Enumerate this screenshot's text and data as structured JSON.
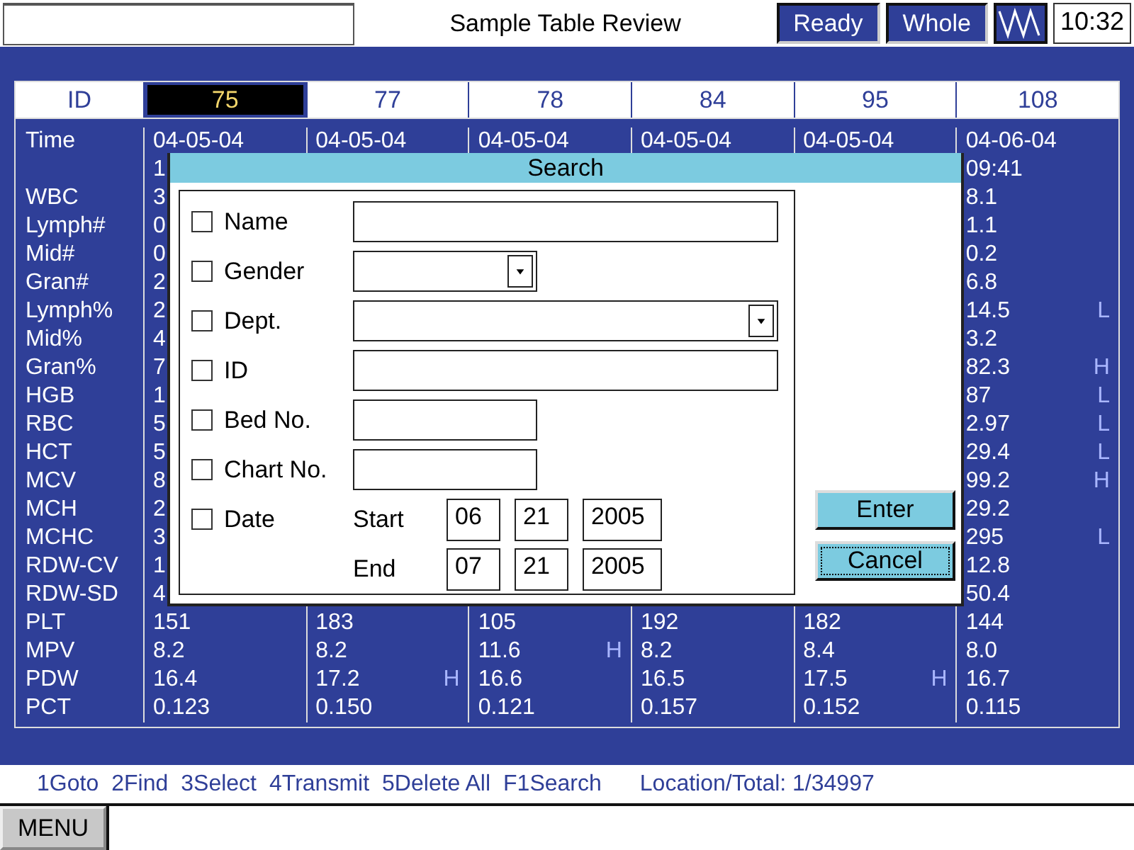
{
  "header": {
    "title": "Sample Table Review",
    "status": [
      "Ready",
      "Whole"
    ],
    "clock": "10:32"
  },
  "table": {
    "id_label": "ID",
    "columns": [
      {
        "id": "75",
        "selected": true
      },
      {
        "id": "77",
        "selected": false
      },
      {
        "id": "78",
        "selected": false
      },
      {
        "id": "84",
        "selected": false
      },
      {
        "id": "95",
        "selected": false
      },
      {
        "id": "108",
        "selected": false
      }
    ],
    "rows": [
      {
        "label": "Time",
        "cells": [
          {
            "value": "04-05-04"
          },
          {
            "value": "04-05-04"
          },
          {
            "value": "04-05-04"
          },
          {
            "value": "04-05-04"
          },
          {
            "value": "04-05-04"
          },
          {
            "value": "04-06-04"
          }
        ]
      },
      {
        "cells": [
          {
            "value": "1"
          },
          null,
          null,
          null,
          null,
          {
            "value": "09:41"
          }
        ]
      },
      {
        "label": "WBC",
        "cells": [
          {
            "value": "3"
          },
          null,
          null,
          null,
          null,
          {
            "value": "8.1"
          }
        ]
      },
      {
        "label": "Lymph#",
        "cells": [
          {
            "value": "0"
          },
          null,
          null,
          null,
          null,
          {
            "value": "1.1"
          }
        ]
      },
      {
        "label": "Mid#",
        "cells": [
          {
            "value": "0"
          },
          null,
          null,
          null,
          null,
          {
            "value": "0.2"
          }
        ]
      },
      {
        "label": "Gran#",
        "cells": [
          {
            "value": "2"
          },
          null,
          null,
          null,
          null,
          {
            "value": "6.8"
          }
        ]
      },
      {
        "label": "Lymph%",
        "cells": [
          {
            "value": "2"
          },
          null,
          null,
          null,
          null,
          {
            "value": "14.5",
            "flag": "L"
          }
        ]
      },
      {
        "label": "Mid%",
        "cells": [
          {
            "value": "4"
          },
          null,
          null,
          null,
          null,
          {
            "value": "3.2"
          }
        ]
      },
      {
        "label": "Gran%",
        "cells": [
          {
            "value": "7"
          },
          null,
          null,
          null,
          null,
          {
            "value": "82.3",
            "flag": "H"
          }
        ]
      },
      {
        "label": "HGB",
        "cells": [
          {
            "value": "1"
          },
          null,
          null,
          null,
          null,
          {
            "value": "87",
            "flag": "L"
          }
        ]
      },
      {
        "label": "RBC",
        "cells": [
          {
            "value": "5"
          },
          null,
          null,
          null,
          null,
          {
            "value": "2.97",
            "flag": "L"
          }
        ]
      },
      {
        "label": "HCT",
        "cells": [
          {
            "value": "5"
          },
          null,
          null,
          null,
          null,
          {
            "value": "29.4",
            "flag": "L"
          }
        ]
      },
      {
        "label": "MCV",
        "cells": [
          {
            "value": "8"
          },
          null,
          null,
          null,
          null,
          {
            "value": "99.2",
            "flag": "H"
          }
        ]
      },
      {
        "label": "MCH",
        "cells": [
          {
            "value": "2"
          },
          null,
          null,
          null,
          null,
          {
            "value": "29.2"
          }
        ]
      },
      {
        "label": "MCHC",
        "cells": [
          {
            "value": "3"
          },
          null,
          null,
          null,
          null,
          {
            "value": "295",
            "flag": "L"
          }
        ]
      },
      {
        "label": "RDW-CV",
        "cells": [
          {
            "value": "1"
          },
          null,
          null,
          null,
          null,
          {
            "value": "12.8"
          }
        ]
      },
      {
        "label": "RDW-SD",
        "cells": [
          {
            "value": "4"
          },
          null,
          null,
          null,
          null,
          {
            "value": "50.4"
          }
        ]
      },
      {
        "label": "PLT",
        "cells": [
          {
            "value": "151"
          },
          {
            "value": "183"
          },
          {
            "value": "105"
          },
          {
            "value": "192"
          },
          {
            "value": "182"
          },
          {
            "value": "144"
          }
        ]
      },
      {
        "label": "MPV",
        "cells": [
          {
            "value": "8.2"
          },
          {
            "value": "8.2"
          },
          {
            "value": "11.6",
            "flag": "H"
          },
          {
            "value": "8.2"
          },
          {
            "value": "8.4"
          },
          {
            "value": "8.0"
          }
        ]
      },
      {
        "label": "PDW",
        "cells": [
          {
            "value": "16.4"
          },
          {
            "value": "17.2",
            "flag": "H"
          },
          {
            "value": "16.6"
          },
          {
            "value": "16.5"
          },
          {
            "value": "17.5",
            "flag": "H"
          },
          {
            "value": "16.7"
          }
        ]
      },
      {
        "label": "PCT",
        "cells": [
          {
            "value": "0.123"
          },
          {
            "value": "0.150"
          },
          {
            "value": "0.121"
          },
          {
            "value": "0.157"
          },
          {
            "value": "0.152"
          },
          {
            "value": "0.115"
          }
        ]
      }
    ]
  },
  "dialog": {
    "title": "Search",
    "criteria": [
      {
        "label": "Name",
        "checked": false,
        "kind": "text",
        "wide": true
      },
      {
        "label": "Gender",
        "checked": false,
        "kind": "select",
        "wide": false
      },
      {
        "label": "Dept.",
        "checked": false,
        "kind": "select",
        "wide": true
      },
      {
        "label": "ID",
        "checked": false,
        "kind": "text",
        "wide": true
      },
      {
        "label": "Bed No.",
        "checked": false,
        "kind": "text",
        "wide": false
      },
      {
        "label": "Chart No.",
        "checked": false,
        "kind": "text",
        "wide": false
      },
      {
        "label": "Date",
        "checked": false,
        "kind": "date",
        "ranges": [
          {
            "label": "Start",
            "parts": [
              "06",
              "21",
              "2005"
            ]
          },
          {
            "label": "End",
            "parts": [
              "07",
              "21",
              "2005"
            ]
          }
        ]
      }
    ],
    "buttons": [
      {
        "label": "Enter",
        "focused": false
      },
      {
        "label": "Cancel",
        "focused": true
      }
    ]
  },
  "footer": {
    "hints": [
      "1Goto",
      "2Find",
      "3Select",
      "4Transmit",
      "5Delete All",
      "F1Search"
    ],
    "location": "Location/Total: 1/34997"
  },
  "menu": {
    "label": "MENU"
  }
}
